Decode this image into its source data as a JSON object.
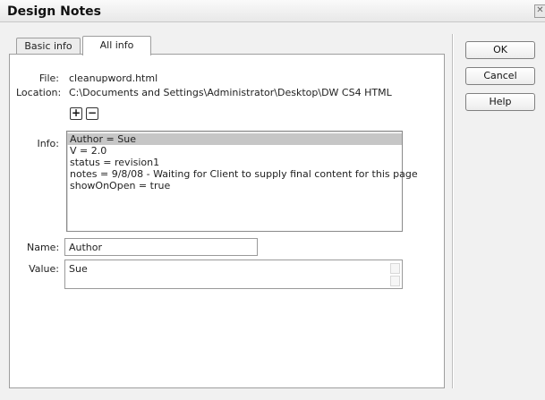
{
  "window": {
    "title": "Design Notes"
  },
  "tabs": [
    {
      "label": "Basic info",
      "active": false
    },
    {
      "label": "All info",
      "active": true
    }
  ],
  "file": {
    "label": "File:",
    "value": "cleanupword.html"
  },
  "location": {
    "label": "Location:",
    "value": "C:\\Documents and Settings\\Administrator\\Desktop\\DW CS4 HTML"
  },
  "info": {
    "label": "Info:",
    "items": [
      "Author = Sue",
      "V = 2.0",
      "status = revision1",
      "notes = 9/8/08 - Waiting for Client to supply final content for this page",
      "showOnOpen = true"
    ],
    "selected_index": 0
  },
  "name_field": {
    "label": "Name:",
    "value": "Author"
  },
  "value_field": {
    "label": "Value:",
    "value": "Sue"
  },
  "buttons": {
    "ok": "OK",
    "cancel": "Cancel",
    "help": "Help",
    "add": "+",
    "remove": "−"
  }
}
